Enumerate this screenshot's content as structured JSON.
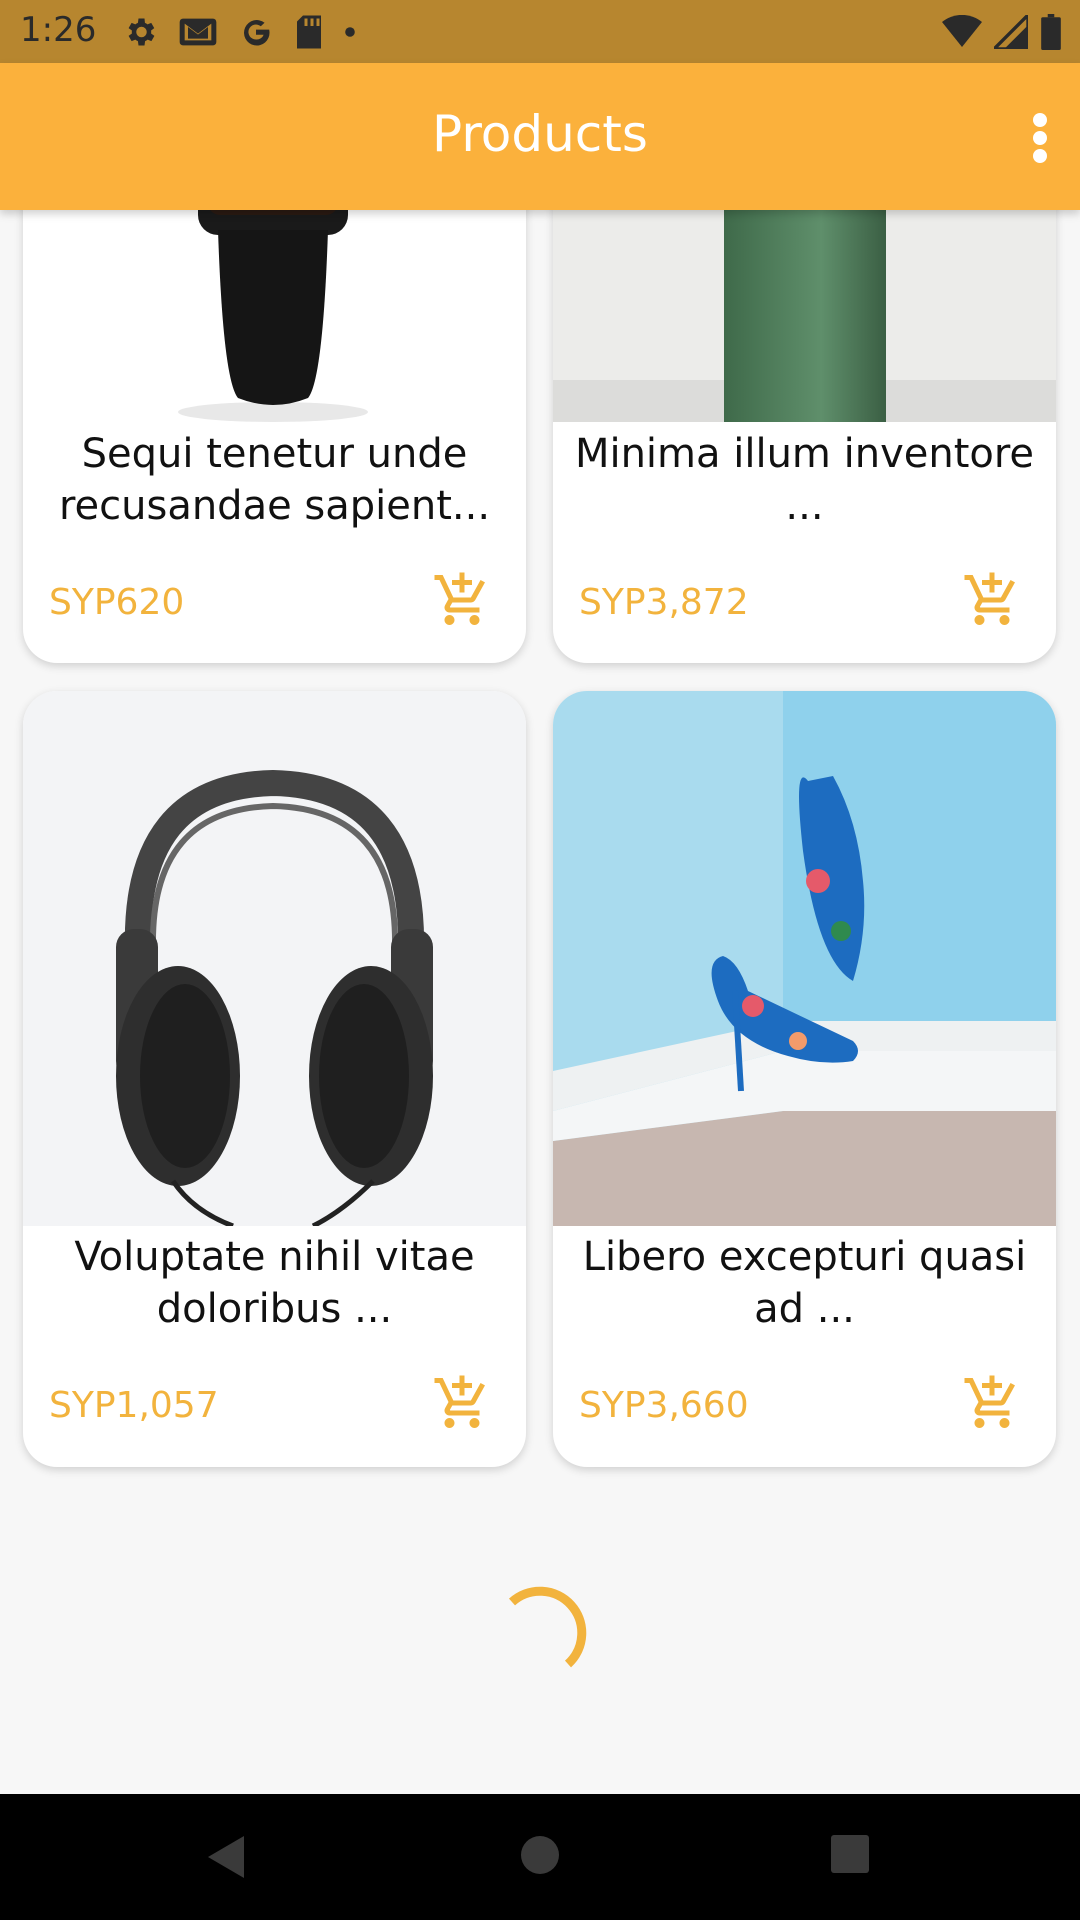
{
  "status_bar": {
    "time": "1:26",
    "left_icons": [
      "settings-icon",
      "gmail-icon",
      "google-icon",
      "sd-card-icon",
      "dot-icon"
    ],
    "right_icons": [
      "wifi-icon",
      "cell-signal-icon",
      "battery-icon"
    ]
  },
  "app_bar": {
    "title": "Products",
    "menu_icon": "more-vert-icon",
    "color": "#fbb13c"
  },
  "products": [
    {
      "title": "Sequi tenetur unde recusandae sapient...",
      "price": "SYP620",
      "image": "smartwatch"
    },
    {
      "title": "Minima illum inventore ...",
      "price": "SYP3,872",
      "image": "green-bottle"
    },
    {
      "title": "Voluptate nihil vitae doloribus ...",
      "price": "SYP1,057",
      "image": "headphones"
    },
    {
      "title": "Libero excepturi quasi ad ...",
      "price": "SYP3,660",
      "image": "high-heel-shoes"
    }
  ],
  "accent_color": "#f2b33d",
  "loading_indicator": "spinner",
  "nav_bar": {
    "buttons": [
      "back-icon",
      "home-icon",
      "recents-icon"
    ]
  }
}
